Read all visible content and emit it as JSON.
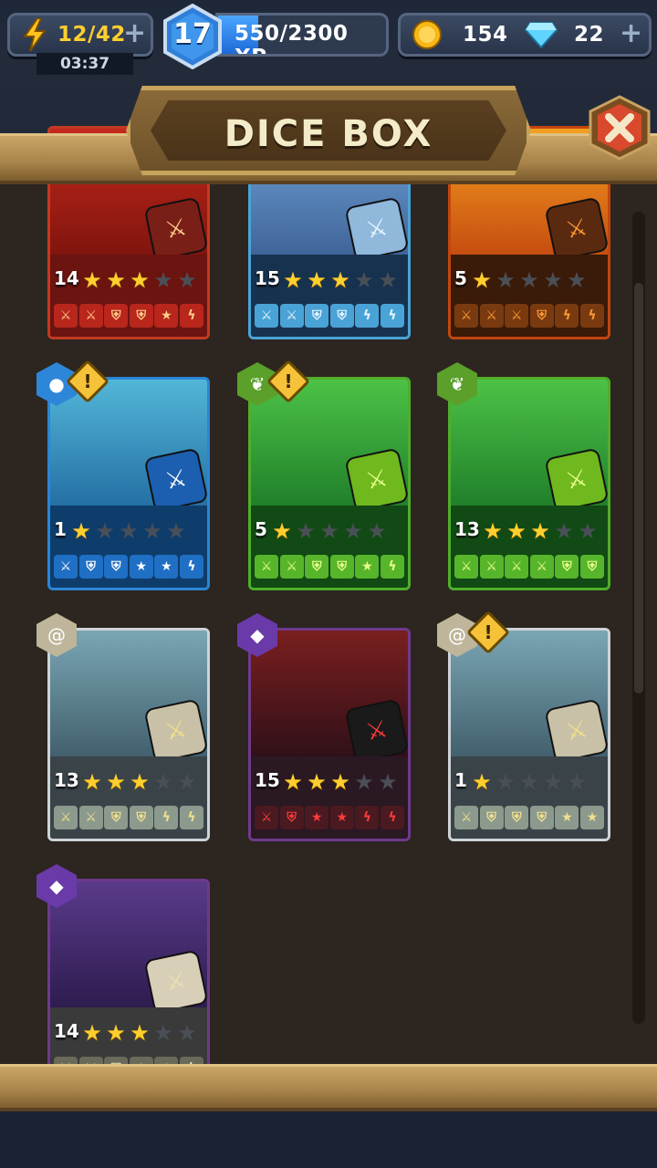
{
  "hud": {
    "energy": "12/42",
    "energy_timer": "03:37",
    "level": "17",
    "xp_text": "550/2300 XP",
    "xp_progress": 0.239,
    "coins": "154",
    "gems": "22"
  },
  "title": "DICE BOX",
  "colors": {
    "accent": "#3f86e0",
    "wood": "#a8834a",
    "star": "#ffcf2e"
  },
  "cards": [
    {
      "name": "red-dragon",
      "level": "14",
      "stars": 3,
      "theme": "red",
      "faces": [
        "sword",
        "sword",
        "shield",
        "shield",
        "star",
        "bolt"
      ],
      "element": null,
      "warning": false
    },
    {
      "name": "yeti",
      "level": "15",
      "stars": 3,
      "theme": "ice",
      "faces": [
        "sword",
        "sword",
        "shield",
        "shield",
        "bolt",
        "bolt"
      ],
      "element": null,
      "warning": false
    },
    {
      "name": "fire-beast",
      "level": "5",
      "stars": 1,
      "theme": "fire",
      "faces": [
        "sword",
        "sword",
        "sword",
        "shield",
        "bolt",
        "bolt"
      ],
      "element": null,
      "warning": false
    },
    {
      "name": "sea-witch",
      "level": "1",
      "stars": 1,
      "theme": "blue",
      "faces": [
        "sword",
        "shield",
        "shield",
        "star",
        "star",
        "bolt"
      ],
      "element": "water",
      "warning": true
    },
    {
      "name": "slime",
      "level": "5",
      "stars": 1,
      "theme": "green",
      "faces": [
        "sword",
        "sword",
        "shield",
        "shield",
        "star",
        "bolt"
      ],
      "element": "nature",
      "warning": true
    },
    {
      "name": "orc",
      "level": "13",
      "stars": 3,
      "theme": "green",
      "faces": [
        "sword",
        "sword",
        "sword",
        "sword",
        "shield",
        "shield"
      ],
      "element": "nature",
      "warning": false
    },
    {
      "name": "wizard",
      "level": "13",
      "stars": 3,
      "theme": "grey",
      "faces": [
        "sword",
        "sword",
        "shield",
        "shield",
        "bolt",
        "bolt"
      ],
      "element": "wind",
      "warning": false
    },
    {
      "name": "vampire",
      "level": "15",
      "stars": 3,
      "theme": "dark",
      "faces": [
        "sword",
        "shield",
        "star",
        "star",
        "bolt",
        "bolt"
      ],
      "element": "arcane",
      "warning": false
    },
    {
      "name": "knight",
      "level": "1",
      "stars": 1,
      "theme": "grey",
      "faces": [
        "sword",
        "shield",
        "shield",
        "shield",
        "star",
        "star"
      ],
      "element": "wind",
      "warning": true
    },
    {
      "name": "skeleton",
      "level": "14",
      "stars": 3,
      "theme": "purple",
      "faces": [
        "sword",
        "sword",
        "shield",
        "star",
        "star",
        "bolt"
      ],
      "element": "arcane",
      "warning": false
    }
  ]
}
